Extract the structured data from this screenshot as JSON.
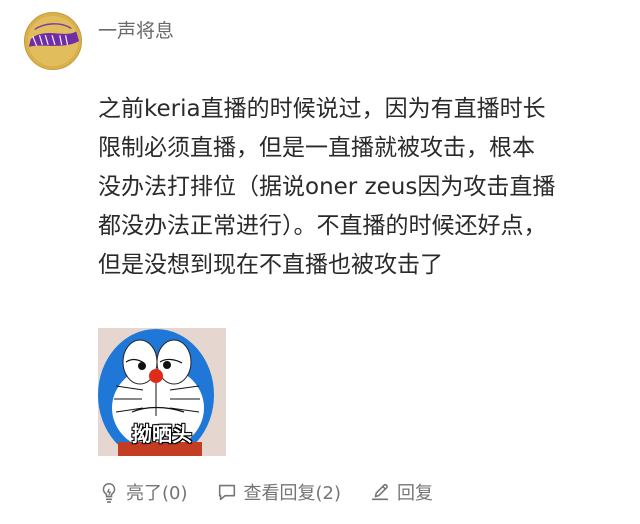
{
  "post": {
    "username": "一声将息",
    "content_lines": [
      "之前keria直播的时候说过，因为有直播时长",
      "限制必须直播，但是一直播就被攻击，根本",
      "没办法打排位（据说oner zeus因为攻击直播",
      "都没办法正常进行）。不直播的时候还好点，",
      "但是没想到现在不直播也被攻击了"
    ],
    "sticker_caption": "拗晒头"
  },
  "actions": {
    "like_label": "亮了(0)",
    "replies_label": "查看回复(2)",
    "reply_label": "回复"
  },
  "colors": {
    "text": "#2a2a2a",
    "muted": "#757575",
    "avatar_gold": "#d9b04d",
    "doraemon_blue": "#1f78d8"
  },
  "icons": {
    "like": "lightbulb-icon",
    "replies": "comment-icon",
    "reply": "edit-icon"
  }
}
